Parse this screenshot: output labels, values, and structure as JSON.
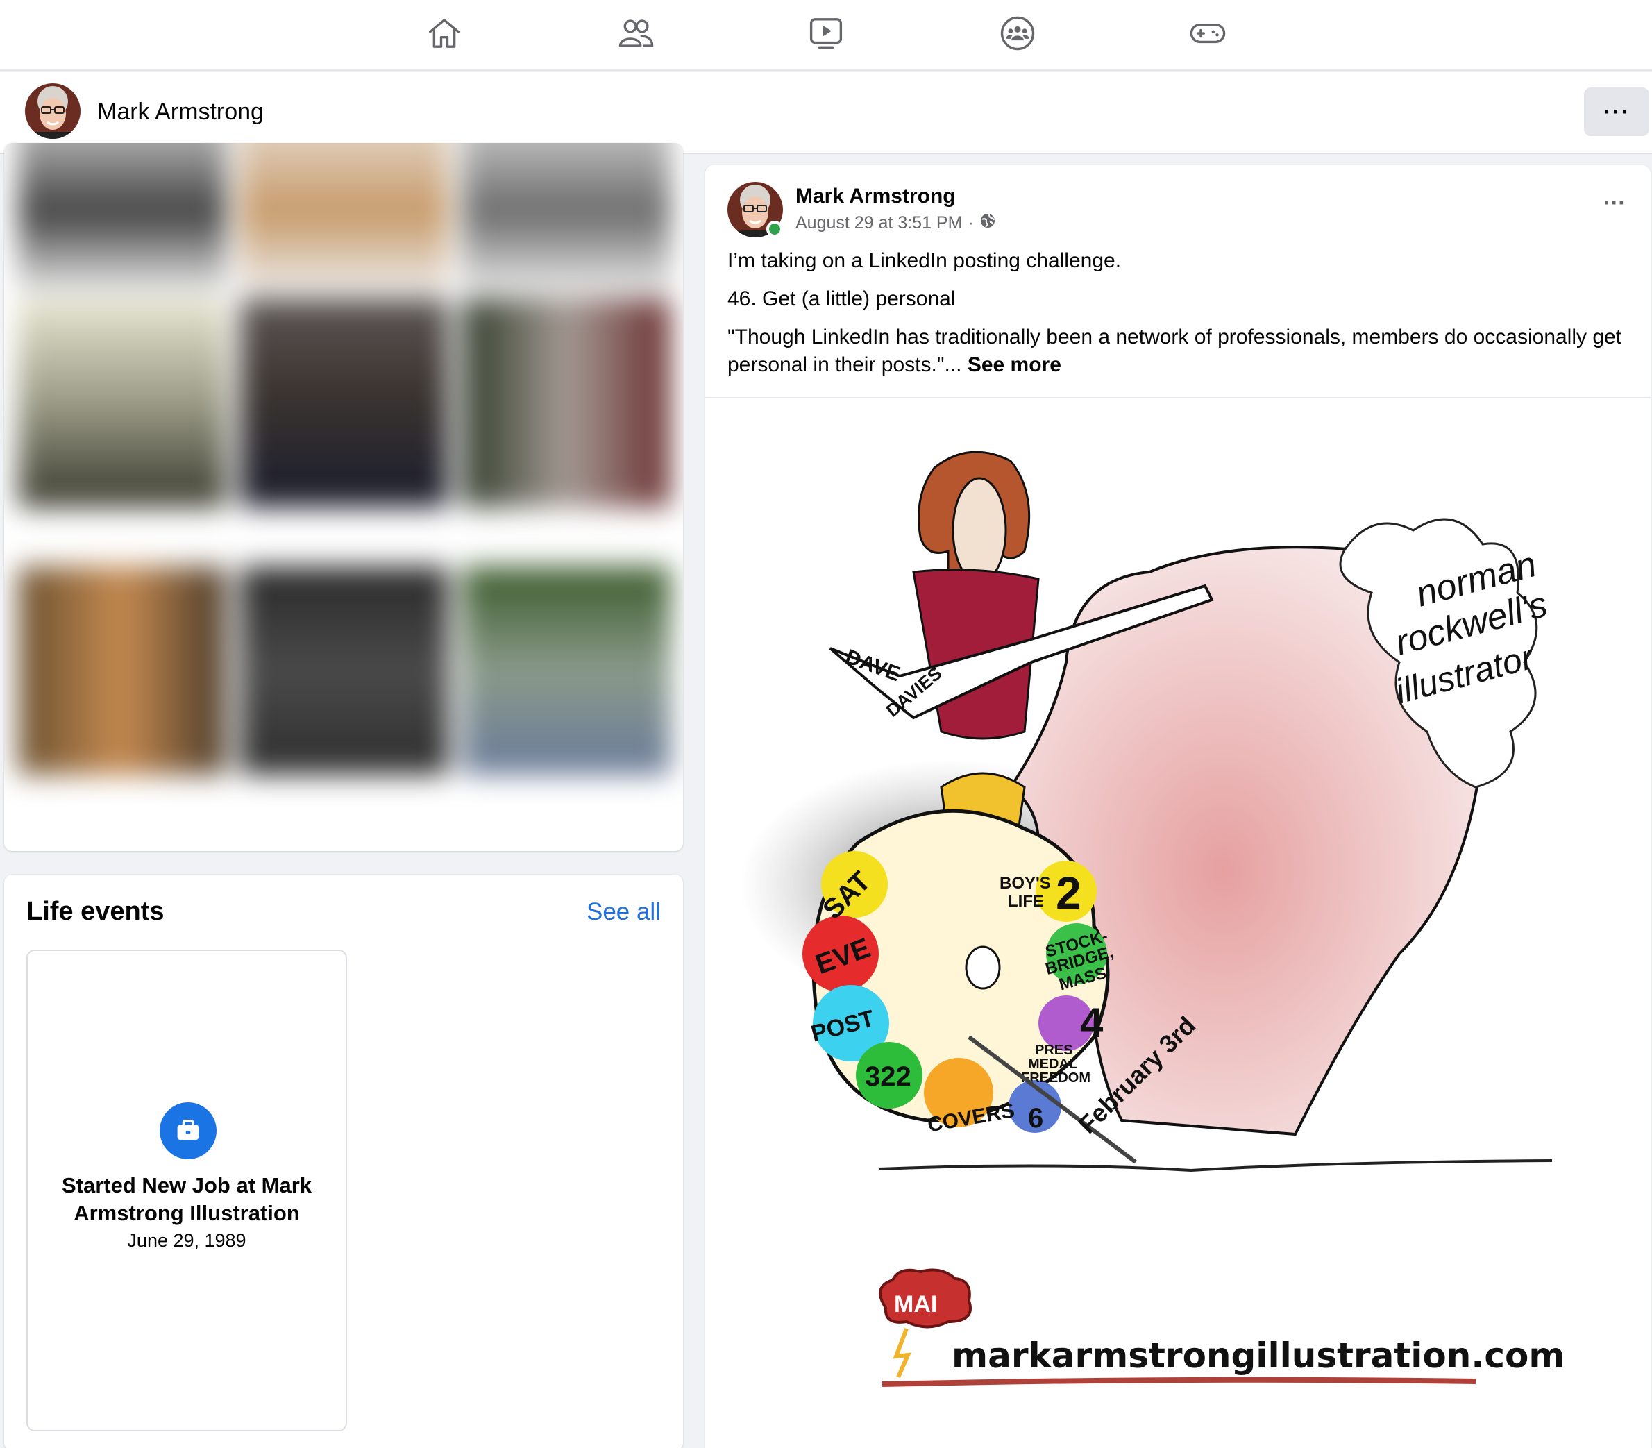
{
  "nav": {
    "items": [
      {
        "name": "home-icon"
      },
      {
        "name": "friends-icon"
      },
      {
        "name": "watch-icon"
      },
      {
        "name": "groups-icon"
      },
      {
        "name": "gaming-icon"
      }
    ]
  },
  "profile": {
    "name": "Mark Armstrong",
    "more_label": "···"
  },
  "life_events": {
    "title": "Life events",
    "see_all": "See all",
    "event": {
      "icon": "briefcase-icon",
      "title": "Started New Job at Mark Armstrong Illustration",
      "date": "June 29, 1989"
    }
  },
  "post": {
    "author": "Mark Armstrong",
    "timestamp": "August 29 at 3:51 PM",
    "separator": "·",
    "privacy_icon": "globe-icon",
    "more_label": "···",
    "line1": "I’m taking on a LinkedIn posting challenge.",
    "line2": "46. Get (a little) personal",
    "line3": "\"Though LinkedIn has traditionally been a network of professionals, members do occasionally get personal in their posts.\"...",
    "see_more": "See more",
    "image": {
      "badge_text": "MAI",
      "website": "markarmstrongillustration.com",
      "guitar_text_1": "DAVE",
      "guitar_text_2": "DAVIES",
      "hair_text_1": "norman",
      "hair_text_2": "rockwell's",
      "hair_text_3": "illustrator",
      "palette_labels": [
        "SAT",
        "EVE",
        "POST",
        "322",
        "COVERS",
        "6",
        "BOY'S",
        "LIFE",
        "2",
        "STOCK-",
        "BRIDGE,",
        "MASS",
        "4",
        "PRES",
        "MEDAL",
        "FREEDOM"
      ],
      "brush_text": "February 3rd"
    }
  }
}
